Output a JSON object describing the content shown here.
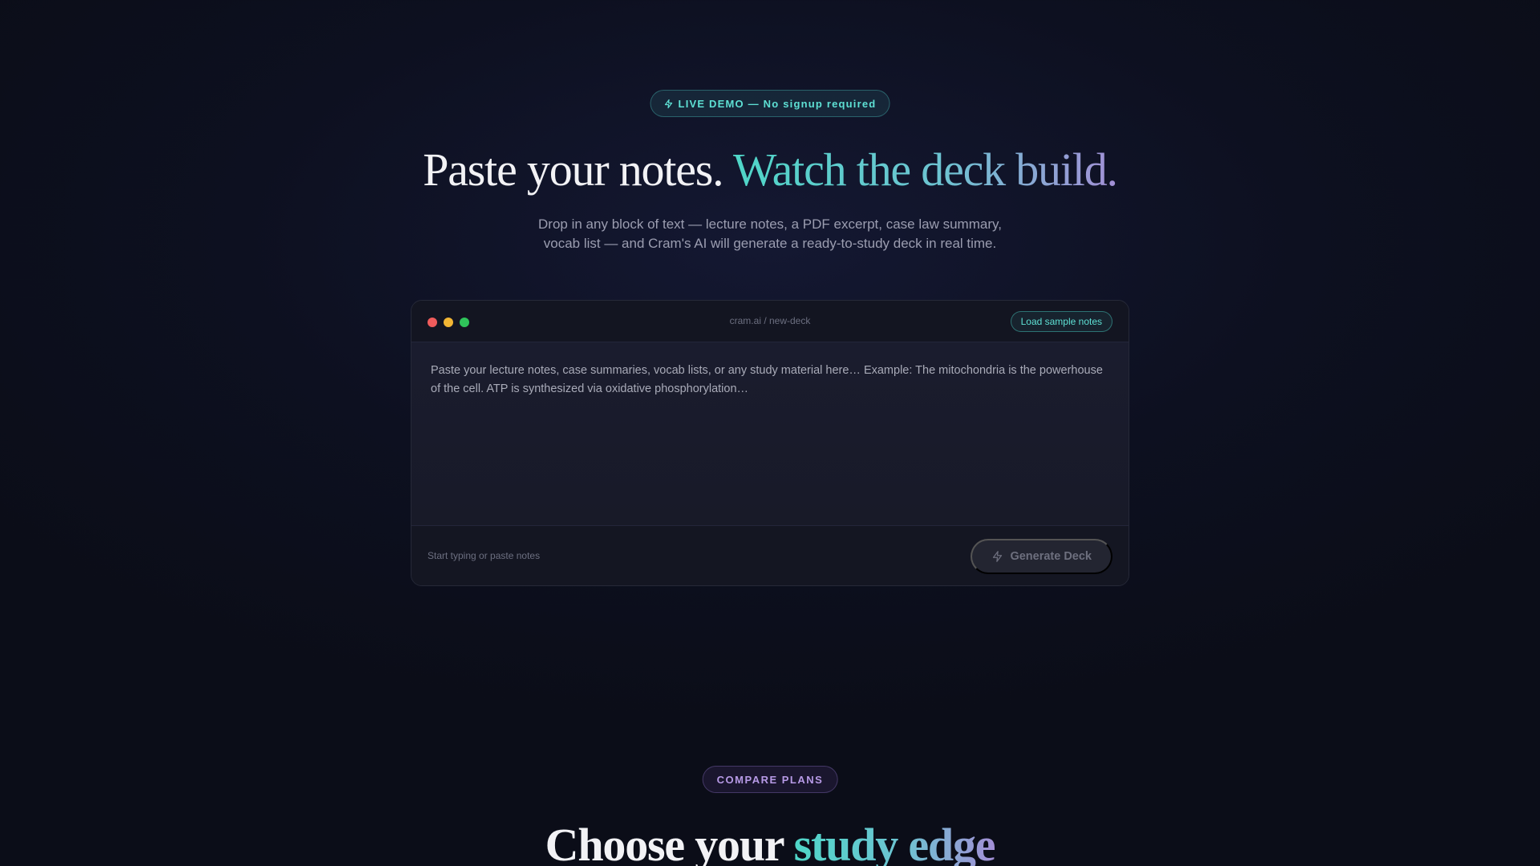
{
  "hero": {
    "badge": {
      "icon": "bolt-icon",
      "text": "LIVE DEMO — No signup required"
    },
    "title_plain": "Paste your notes. ",
    "title_highlight": "Watch the deck build.",
    "subtitle_line1": "Drop in any block of text — lecture notes, a PDF excerpt, case law summary,",
    "subtitle_line2": "vocab list — and Cram's AI will generate a ready-to-study deck in real time."
  },
  "editor": {
    "path": "cram.ai / new-deck",
    "load_sample_label": "Load sample notes",
    "placeholder": "Paste your lecture notes, case summaries, vocab lists, or any study material here… Example: The mitochondria is the powerhouse of the cell. ATP is synthesized via oxidative phosphorylation…",
    "status": "Start typing or paste notes",
    "generate_label": "Generate Deck",
    "generate_icon": "bolt-icon"
  },
  "plans": {
    "badge": "COMPARE PLANS",
    "title_plain": "Choose your ",
    "title_highlight": "study edge"
  },
  "colors": {
    "accent_teal": "#5ee0d4",
    "accent_purple": "#b79ae6",
    "background": "#0d1020"
  }
}
